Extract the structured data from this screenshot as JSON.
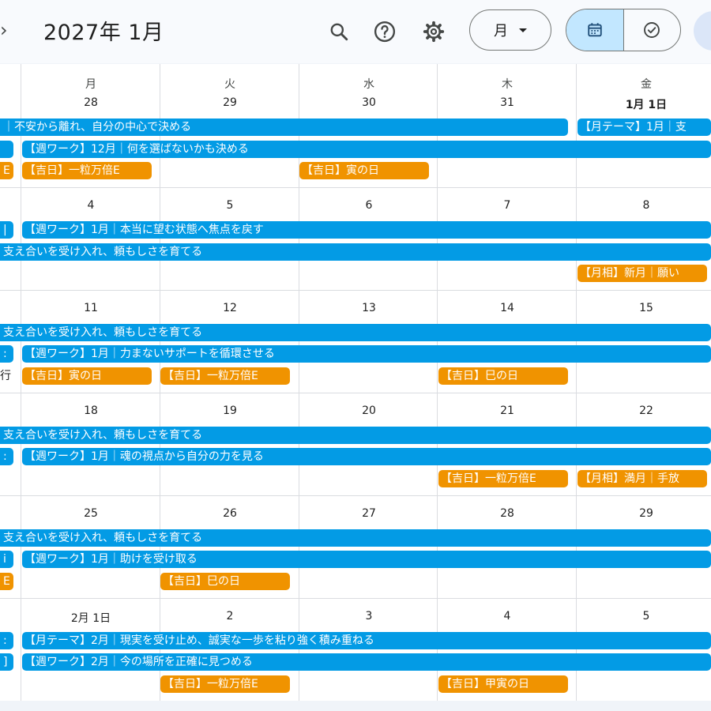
{
  "header": {
    "next_glyph": "›",
    "title": "2027年 1月",
    "view_label": "月"
  },
  "weekdays": [
    "月",
    "火",
    "水",
    "木",
    "金"
  ],
  "weeks": [
    {
      "days": [
        "28",
        "29",
        "30",
        "31",
        "1月 1日"
      ],
      "events": [
        {
          "text": "｜不安から離れ、自分の中心で決める",
          "color": "blue"
        },
        {
          "text": "【月テーマ】1月｜支",
          "color": "blue"
        },
        {
          "text": "",
          "color": "blue"
        },
        {
          "text": "【週ワーク】12月｜何を選ばないかも決める",
          "color": "blue"
        },
        {
          "text": "E",
          "color": "orange"
        },
        {
          "text": "【吉日】一粒万倍E",
          "color": "orange"
        },
        {
          "text": "【吉日】寅の日",
          "color": "orange"
        }
      ]
    },
    {
      "days": [
        "4",
        "5",
        "6",
        "7",
        "8"
      ],
      "events": [
        {
          "text": "|",
          "color": "blue"
        },
        {
          "text": "【週ワーク】1月｜本当に望む状態へ焦点を戻す",
          "color": "blue"
        },
        {
          "text": "支え合いを受け入れ、頼もしさを育てる",
          "color": "blue"
        },
        {
          "text": "【月相】新月｜願い",
          "color": "orange"
        }
      ]
    },
    {
      "days": [
        "11",
        "12",
        "13",
        "14",
        "15"
      ],
      "events": [
        {
          "text": "支え合いを受け入れ、頼もしさを育てる",
          "color": "blue"
        },
        {
          "text": ":",
          "color": "blue"
        },
        {
          "text": "【週ワーク】1月｜力まないサポートを循環させる",
          "color": "blue"
        },
        {
          "text": "行",
          "color": "plain"
        },
        {
          "text": "【吉日】寅の日",
          "color": "orange"
        },
        {
          "text": "【吉日】一粒万倍E",
          "color": "orange"
        },
        {
          "text": "【吉日】巳の日",
          "color": "orange"
        }
      ]
    },
    {
      "days": [
        "18",
        "19",
        "20",
        "21",
        "22"
      ],
      "events": [
        {
          "text": "支え合いを受け入れ、頼もしさを育てる",
          "color": "blue"
        },
        {
          "text": ":",
          "color": "blue"
        },
        {
          "text": "【週ワーク】1月｜魂の視点から自分の力を見る",
          "color": "blue"
        },
        {
          "text": "【吉日】一粒万倍E",
          "color": "orange"
        },
        {
          "text": "【月相】満月｜手放",
          "color": "orange"
        }
      ]
    },
    {
      "days": [
        "25",
        "26",
        "27",
        "28",
        "29"
      ],
      "events": [
        {
          "text": "支え合いを受け入れ、頼もしさを育てる",
          "color": "blue"
        },
        {
          "text": "i",
          "color": "blue"
        },
        {
          "text": "【週ワーク】1月｜助けを受け取る",
          "color": "blue"
        },
        {
          "text": "E",
          "color": "orange"
        },
        {
          "text": "【吉日】巳の日",
          "color": "orange"
        }
      ]
    },
    {
      "days": [
        "2月 1日",
        "2",
        "3",
        "4",
        "5"
      ],
      "events": [
        {
          "text": ":",
          "color": "blue"
        },
        {
          "text": "【月テーマ】2月｜現実を受け止め、誠実な一歩を粘り強く積み重ねる",
          "color": "blue"
        },
        {
          "text": "]",
          "color": "blue"
        },
        {
          "text": "【週ワーク】2月｜今の場所を正確に見つめる",
          "color": "blue"
        },
        {
          "text": "【吉日】一粒万倍E",
          "color": "orange"
        },
        {
          "text": "【吉日】甲寅の日",
          "color": "orange"
        }
      ]
    }
  ],
  "icons": {
    "search": "search-icon",
    "help": "help-icon",
    "settings": "gear-icon",
    "dropdown": "chevron-down-icon",
    "calendar": "calendar-icon",
    "tasks": "check-circle-icon"
  },
  "colors": {
    "event_blue": "#039be5",
    "event_orange": "#f09300",
    "selected_view": "#c2e7ff",
    "background": "#f8fafd"
  }
}
